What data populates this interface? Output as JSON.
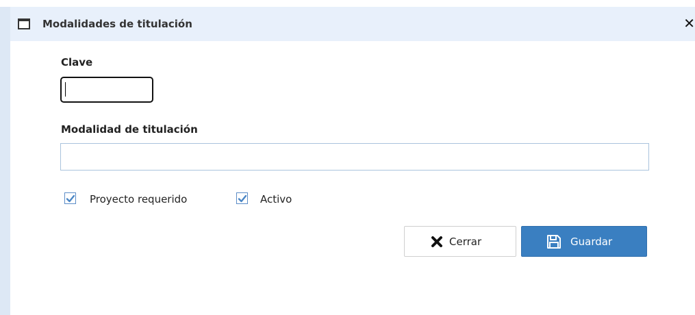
{
  "window": {
    "title": "Modalidades de titulación",
    "icon": "window-icon",
    "close_icon": "close-icon"
  },
  "form": {
    "clave": {
      "label": "Clave",
      "value": "",
      "placeholder": ""
    },
    "modalidad": {
      "label": "Modalidad de titulación",
      "value": "",
      "placeholder": ""
    },
    "checkboxes": [
      {
        "label": "Proyecto requerido",
        "checked": true
      },
      {
        "label": "Activo",
        "checked": true
      }
    ]
  },
  "actions": {
    "cerrar": {
      "label": "Cerrar",
      "icon": "close-x-icon"
    },
    "guardar": {
      "label": "Guardar",
      "icon": "floppy-disk-icon"
    }
  },
  "colors": {
    "titlebar_bg": "#e8f0fb",
    "accent": "#3a7fc1",
    "checkbox_check": "#4a86c5",
    "input_border": "#a9c3dd"
  }
}
